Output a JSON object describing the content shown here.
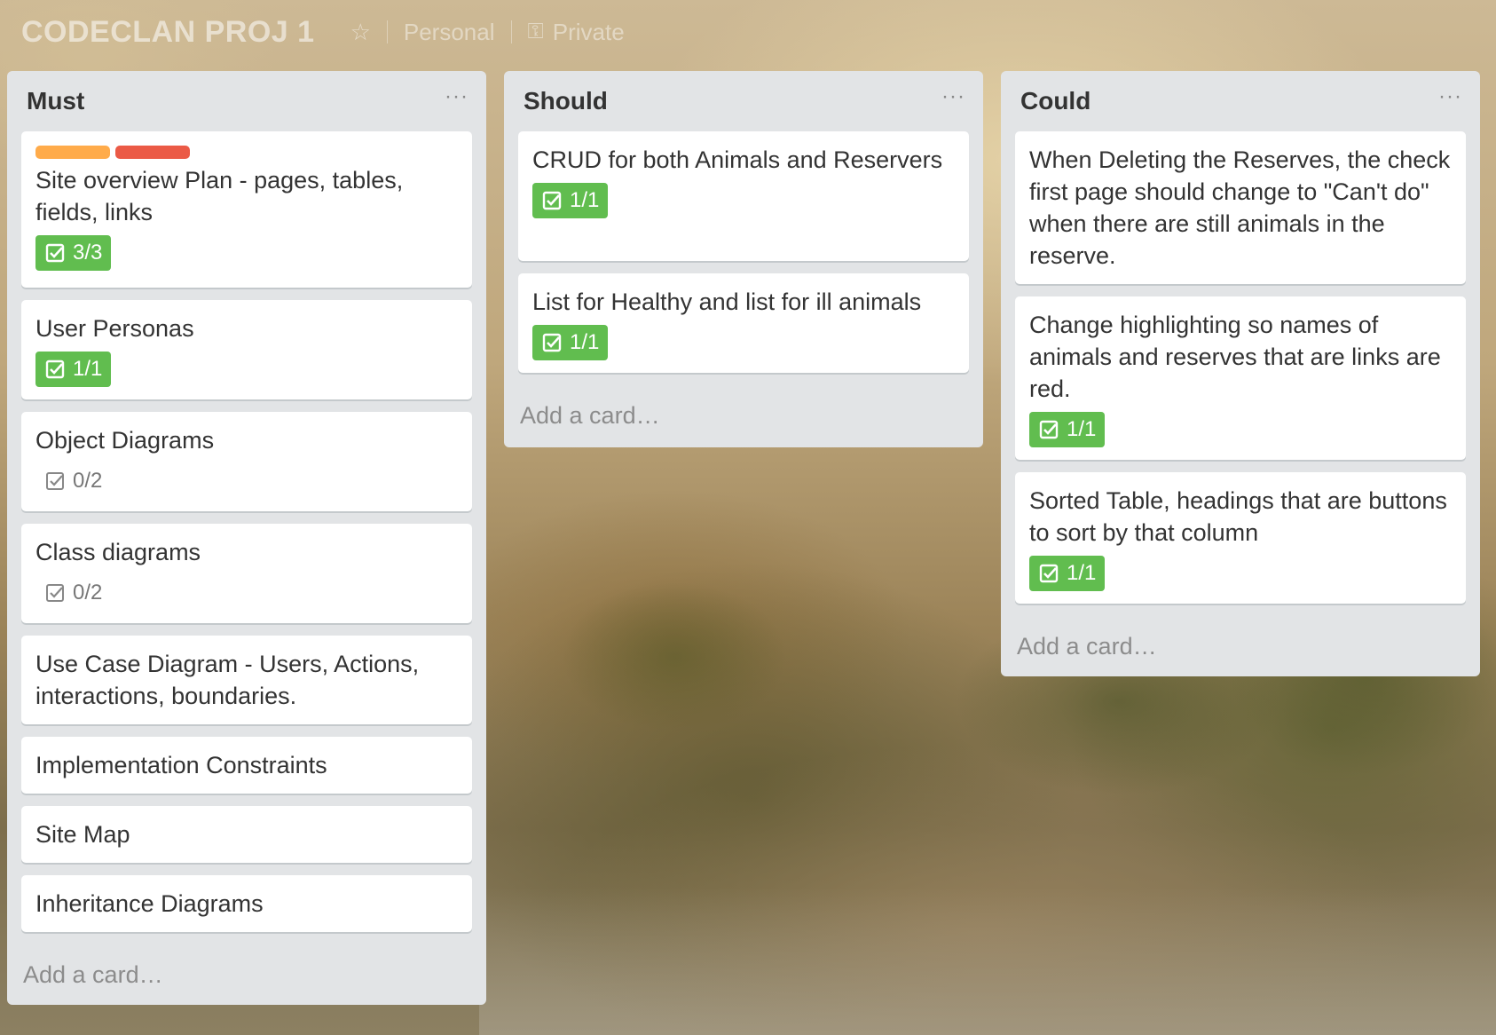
{
  "board": {
    "title": "CODECLAN PROJ 1",
    "star_icon": "star-icon",
    "personal_label": "Personal",
    "visibility_label": "Private",
    "background": "misty-forest-river"
  },
  "colors": {
    "list_bg": "#e2e4e6",
    "badge_complete": "#61bd4f",
    "label_orange": "#ffab4a",
    "label_red": "#eb5a46"
  },
  "lists": [
    {
      "title": "Must",
      "menu": "···",
      "add_card": "Add a card…",
      "cards": [
        {
          "title": "Site overview Plan - pages, tables, fields, links",
          "labels": [
            "orange",
            "red"
          ],
          "checklist": "3/3",
          "complete": true
        },
        {
          "title": "User Personas",
          "checklist": "1/1",
          "complete": true
        },
        {
          "title": "Object Diagrams",
          "checklist": "0/2",
          "complete": false
        },
        {
          "title": "Class diagrams",
          "checklist": "0/2",
          "complete": false
        },
        {
          "title": "Use Case Diagram - Users, Actions, interactions, boundaries."
        },
        {
          "title": "Implementation Constraints"
        },
        {
          "title": "Site Map"
        },
        {
          "title": "Inheritance Diagrams"
        }
      ]
    },
    {
      "title": "Should",
      "menu": "···",
      "add_card": "Add a card…",
      "cards": [
        {
          "title": "CRUD for both Animals and Reservers",
          "checklist": "1/1",
          "complete": true
        },
        {
          "title": "List for Healthy and list for ill animals",
          "checklist": "1/1",
          "complete": true
        }
      ]
    },
    {
      "title": "Could",
      "menu": "···",
      "add_card": "Add a card…",
      "cards": [
        {
          "title": "When Deleting the Reserves, the check first page should change to \"Can't do\" when there are still animals in the reserve."
        },
        {
          "title": "Change highlighting so names of animals and reserves that are links are red.",
          "checklist": "1/1",
          "complete": true
        },
        {
          "title": "Sorted Table, headings that are buttons to sort by that column",
          "checklist": "1/1",
          "complete": true
        }
      ]
    }
  ]
}
